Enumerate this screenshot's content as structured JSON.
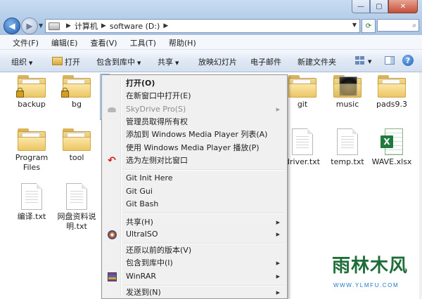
{
  "window": {
    "controls": {
      "minimize": "—",
      "maximize": "▢",
      "close": "✕"
    }
  },
  "address": {
    "crumbs": [
      "计算机",
      "software (D:)"
    ]
  },
  "menubar": {
    "items": [
      "文件(F)",
      "编辑(E)",
      "查看(V)",
      "工具(T)",
      "帮助(H)"
    ]
  },
  "commandbar": {
    "organize": "组织",
    "open": "打开",
    "include_library": "包含到库中",
    "share": "共享",
    "slideshow": "放映幻灯片",
    "email": "电子邮件",
    "new_folder": "新建文件夹"
  },
  "files": [
    {
      "name": "backup",
      "type": "folder-locked"
    },
    {
      "name": "bg",
      "type": "folder-locked"
    },
    {
      "name": "git",
      "type": "folder"
    },
    {
      "name": "music",
      "type": "folder-music"
    },
    {
      "name": "pads9.3",
      "type": "folder"
    },
    {
      "name": "Program Files",
      "type": "folder"
    },
    {
      "name": "tool",
      "type": "folder"
    },
    {
      "name": "driver.txt",
      "type": "txt"
    },
    {
      "name": "temp.txt",
      "type": "txt"
    },
    {
      "name": "WAVE.xlsx",
      "type": "xlsx"
    },
    {
      "name": "编译.txt",
      "type": "txt"
    },
    {
      "name": "网盘资料说明.txt",
      "type": "txt"
    }
  ],
  "context_menu": {
    "items": [
      {
        "label": "打开(O)",
        "bold": true
      },
      {
        "label": "在新窗口中打开(E)"
      },
      {
        "label": "SkyDrive Pro(S)",
        "disabled": true,
        "submenu": true,
        "icon": "cloud-icon"
      },
      {
        "label": "管理员取得所有权"
      },
      {
        "label": "添加到 Windows Media Player 列表(A)"
      },
      {
        "label": "使用 Windows Media Player 播放(P)"
      },
      {
        "label": "选为左侧对比窗口",
        "icon": "undo-icon"
      },
      {
        "label": "Git Init Here"
      },
      {
        "label": "Git Gui"
      },
      {
        "label": "Git Bash"
      },
      {
        "label": "共享(H)",
        "submenu": true
      },
      {
        "label": "UltraISO",
        "submenu": true,
        "icon": "disc-icon"
      },
      {
        "label": "还原以前的版本(V)"
      },
      {
        "label": "包含到库中(I)",
        "submenu": true
      },
      {
        "label": "WinRAR",
        "submenu": true,
        "icon": "rar-icon"
      },
      {
        "label": "发送到(N)",
        "submenu": true
      }
    ]
  },
  "watermark": {
    "text": "雨林木风",
    "url": "WWW.YLMFU.COM"
  }
}
